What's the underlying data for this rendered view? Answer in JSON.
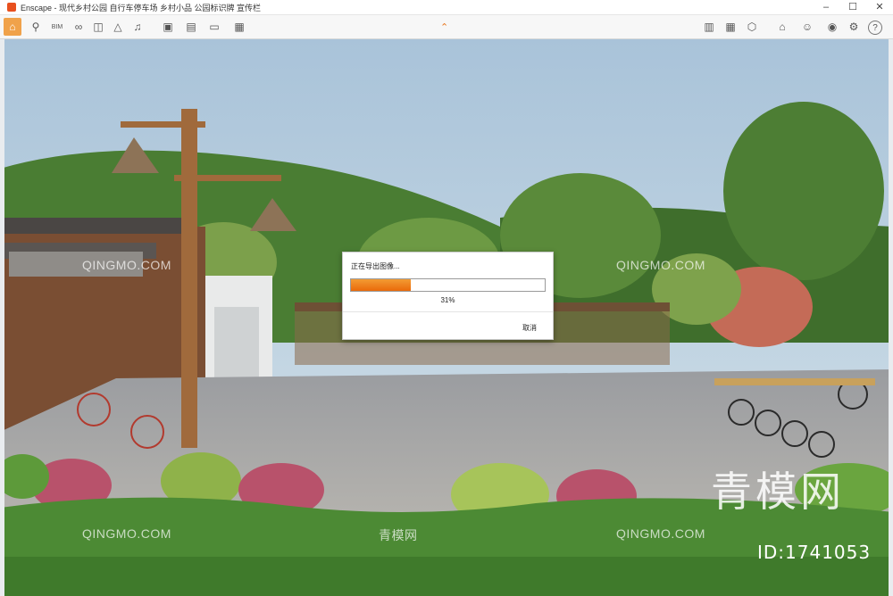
{
  "window": {
    "app_name": "Enscape",
    "title": "Enscape - 现代乡村公园 自行车停车场 乡村小品 公园标识牌 宣传栏",
    "controls": [
      "–",
      "☐",
      "✕"
    ]
  },
  "toolbar": {
    "left_icons": [
      "home-icon",
      "location-icon",
      "bim-icon",
      "binoculars-icon",
      "cube-icon",
      "mountain-icon",
      "bell-icon",
      "clapper-icon",
      "export-image-icon",
      "export-batch-icon",
      "export-video-icon",
      "export-panorama-icon"
    ],
    "right_icons": [
      "map-icon",
      "asset-library-icon",
      "cube-view-icon",
      "collaboration-icon",
      "chat-icon",
      "visibility-icon",
      "settings-icon",
      "help-icon"
    ]
  },
  "dialog": {
    "title": "正在导出图像...",
    "progress": 0.31,
    "percent_label": "31%",
    "cancel_label": "取消"
  },
  "watermarks": {
    "small": "QINGMO.COM",
    "cn": "青模网",
    "big": "青模网",
    "id": "ID:1741053"
  },
  "colors": {
    "accent": "#e8761e",
    "progress": "#ea6a0a",
    "sky": "#b9cfe0",
    "grass": "#3d7a2a"
  }
}
